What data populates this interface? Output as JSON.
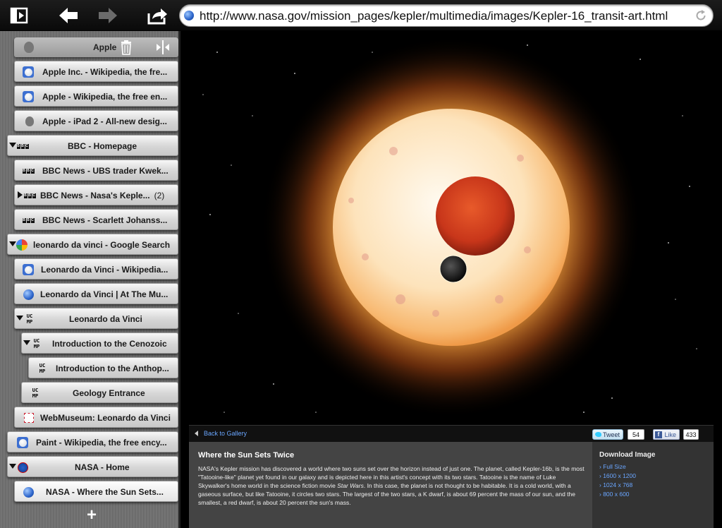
{
  "browser": {
    "url": "http://www.nasa.gov/mission_pages/kepler/multimedia/images/Kepler-16_transit-art.html"
  },
  "sidebar": {
    "header": {
      "label": "Apple"
    },
    "add_label": "+",
    "tabs": [
      {
        "label": "Apple Inc. - Wikipedia, the fre...",
        "icon": "wikipedia-icon"
      },
      {
        "label": "Apple - Wikipedia, the free en...",
        "icon": "wikipedia-icon"
      },
      {
        "label": "Apple - iPad 2 - All-new desig...",
        "icon": "apple-icon"
      },
      {
        "label": "BBC - Homepage",
        "icon": "bbc-icon"
      },
      {
        "label": "BBC News - UBS trader Kwek...",
        "icon": "bbc-icon"
      },
      {
        "label": "BBC News - Nasa's Keple...",
        "icon": "bbc-icon",
        "count": "(2)"
      },
      {
        "label": "BBC News - Scarlett Johanss...",
        "icon": "bbc-icon"
      },
      {
        "label": "leonardo da vinci - Google Search",
        "icon": "google-icon"
      },
      {
        "label": "Leonardo da Vinci - Wikipedia...",
        "icon": "wikipedia-icon"
      },
      {
        "label": "Leonardo da Vinci | At The Mu...",
        "icon": "globe-icon"
      },
      {
        "label": "Leonardo da Vinci",
        "icon": "ucmp-icon"
      },
      {
        "label": "Introduction to the Cenozoic",
        "icon": "ucmp-icon"
      },
      {
        "label": "Introduction to the Anthop...",
        "icon": "ucmp-icon"
      },
      {
        "label": "Geology Entrance",
        "icon": "ucmp-icon"
      },
      {
        "label": "WebMuseum: Leonardo da Vinci",
        "icon": "webmuseum-icon"
      },
      {
        "label": "Paint - Wikipedia, the free ency...",
        "icon": "wikipedia-icon"
      },
      {
        "label": "NASA - Home",
        "icon": "nasa-icon"
      },
      {
        "label": "NASA - Where the Sun Sets...",
        "icon": "globe-icon",
        "active": true
      }
    ]
  },
  "page": {
    "back_to_gallery": "Back to Gallery",
    "tweet_label": "Tweet",
    "tweet_count": "54",
    "like_label": "Like",
    "like_count": "433",
    "title": "Where the Sun Sets Twice",
    "description": {
      "part1": "NASA's Kepler mission has discovered a world where two suns set over the horizon instead of just one. The planet, called Kepler-16b, is the most \"Tatooine-like\" planet yet found in our galaxy and is depicted here in this artist's concept with its two stars. Tatooine is the name of Luke Skywalker's home world in the science fiction movie ",
      "italic": "Star Wars",
      "part2": ". In this case, the planet is not thought to be habitable. It is a cold world, with a gaseous surface, but like Tatooine, it circles two stars. The largest of the two stars, a K dwarf, is about 69 percent the mass of our sun, and the smallest, a red dwarf, is about 20 percent the sun's mass."
    },
    "download": {
      "title": "Download Image",
      "links": [
        "› Full Size",
        "› 1600 x 1200",
        "› 1024 x 768",
        "› 800 x 600"
      ]
    }
  }
}
